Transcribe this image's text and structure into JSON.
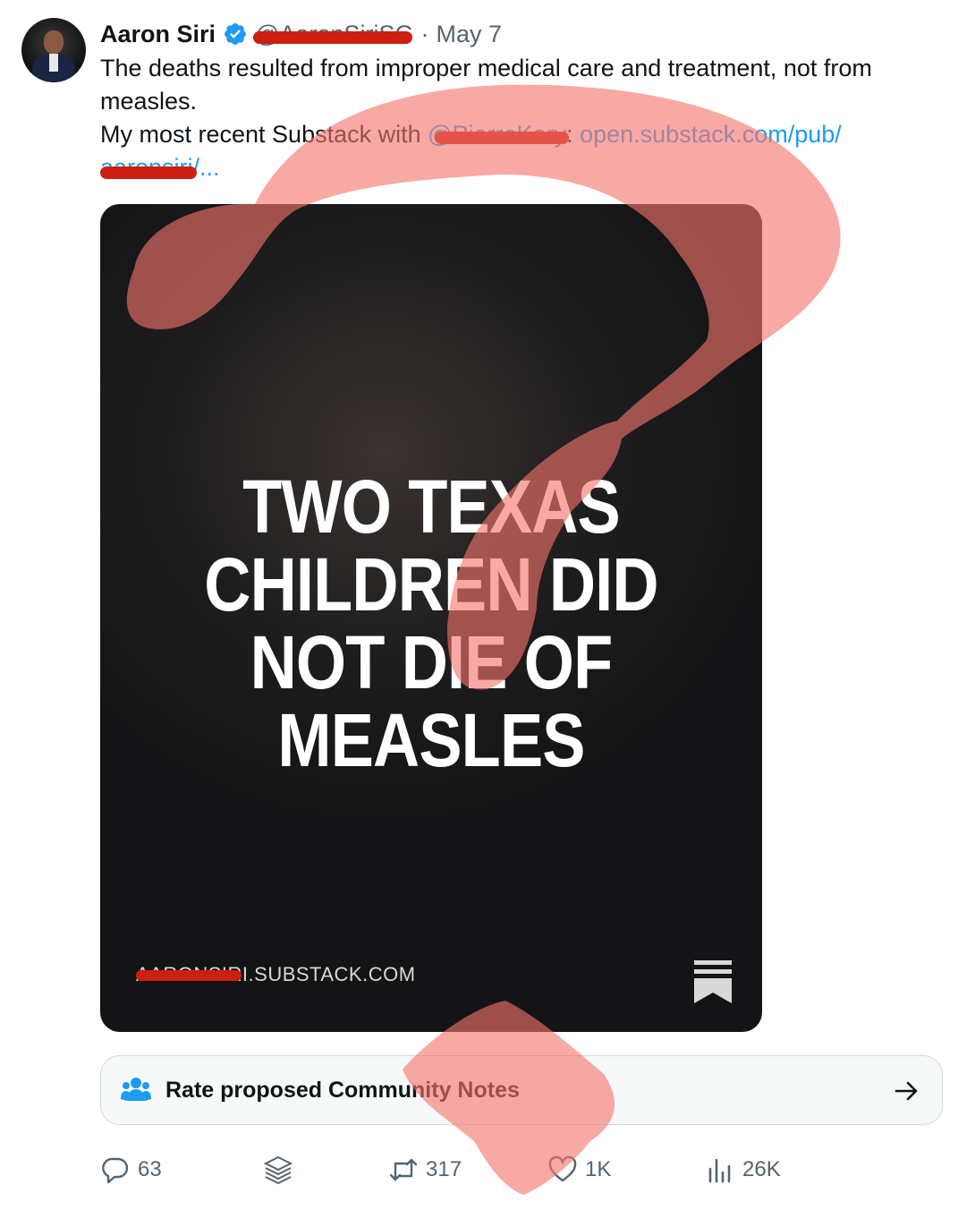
{
  "tweet": {
    "author_name": "Aaron Siri",
    "handle": "@AaronSiriSG",
    "separator": "·",
    "date": "May 7",
    "text_line1": "The deaths resulted from improper medical care and treatment, not from",
    "text_line2": "measles.",
    "text_line3_prefix": "My most recent Substack with ",
    "text_line3_mention": "@PierreKory",
    "text_line3_suffix": ": ",
    "link_part1": "open.substack.com/pub/",
    "link_part2_prefix": "aaronsiri",
    "link_part2_suffix": "/..."
  },
  "card": {
    "headline_line1": "TWO TEXAS",
    "headline_line2": "CHILDREN DID",
    "headline_line3": "NOT DIE OF",
    "headline_line4": "MEASLES",
    "domain_prefix": "AARONSIRI",
    "domain_suffix": ".SUBSTACK.COM"
  },
  "community_notes": {
    "label": "Rate proposed Community Notes"
  },
  "actions": {
    "replies": "63",
    "retweets": "317",
    "likes": "1K",
    "views": "26K"
  },
  "icons": {
    "verified": "verified-badge-icon",
    "notes": "people-icon",
    "arrow": "arrow-right-icon",
    "reply": "reply-icon",
    "grok": "grok-icon",
    "retweet": "retweet-icon",
    "like": "heart-icon",
    "views": "analytics-icon",
    "bookmark": "substack-logo-icon"
  },
  "colors": {
    "link": "#1d9bf0",
    "redaction": "#cc1f12",
    "question_mark_overlay": "#f4756a"
  }
}
